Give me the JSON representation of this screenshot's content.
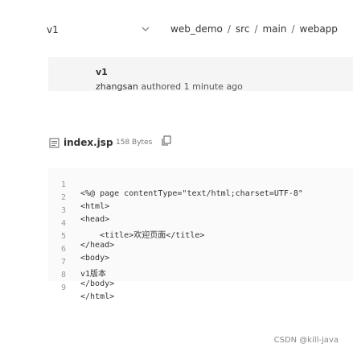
{
  "header": {
    "branch": "v1",
    "breadcrumb": [
      "web_demo",
      "src",
      "main",
      "webapp"
    ]
  },
  "commit": {
    "message": "v1",
    "author": "zhangsan",
    "action": "authored",
    "time": "1 minute ago"
  },
  "file": {
    "name": "index.jsp",
    "size": "158 Bytes"
  },
  "code_lines": [
    {
      "n": "1",
      "text": "<%@ page contentType=\"text/html;charset=UTF-8\""
    },
    {
      "n": "2",
      "text": "<html>"
    },
    {
      "n": "3",
      "text": "<head>"
    },
    {
      "n": "4",
      "text": "    <title>欢迎页面</title>"
    },
    {
      "n": "5",
      "text": "</head>"
    },
    {
      "n": "6",
      "text": "<body>"
    },
    {
      "n": "7",
      "text": "v1版本"
    },
    {
      "n": "8",
      "text": "</body>"
    },
    {
      "n": "9",
      "text": "</html>"
    }
  ],
  "watermark": "CSDN @kill-java",
  "colors": {
    "code_string": "#1d4f91",
    "commit_bg": "#f5f5f5"
  },
  "icons": [
    "chevron-down-icon",
    "file-icon",
    "copy-icon"
  ]
}
